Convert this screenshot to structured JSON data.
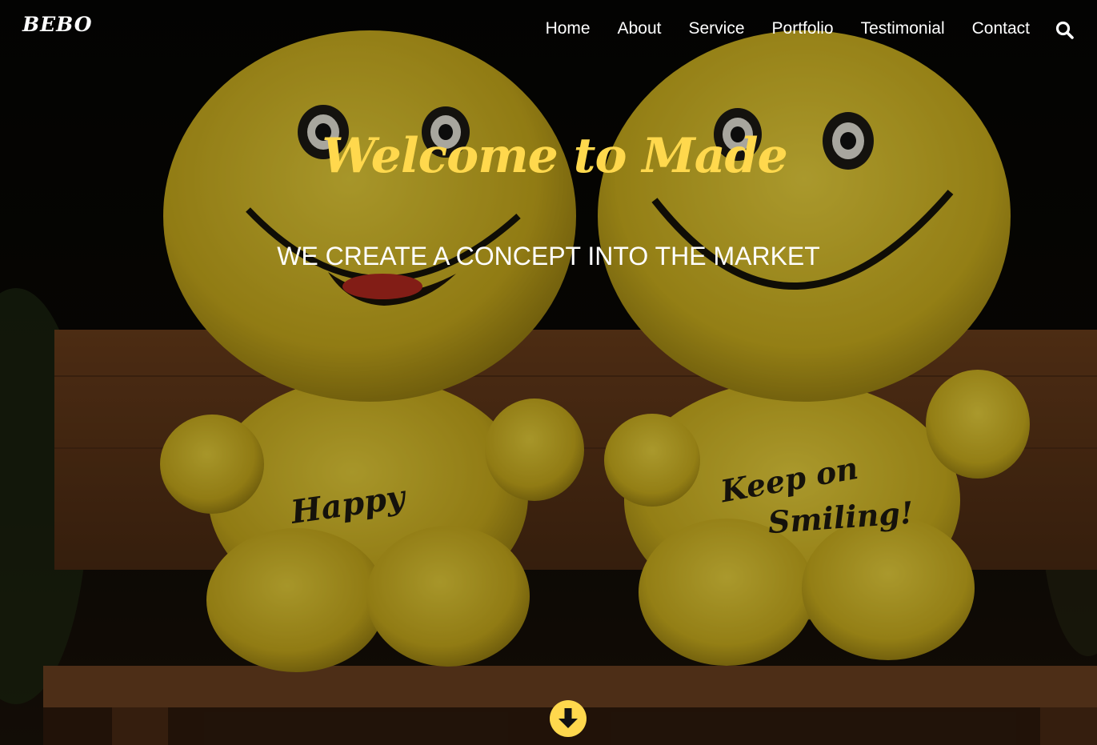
{
  "brand": {
    "name": "BEBO"
  },
  "nav": {
    "items": [
      {
        "label": "Home"
      },
      {
        "label": "About"
      },
      {
        "label": "Service"
      },
      {
        "label": "Portfolio"
      },
      {
        "label": "Testimonial"
      },
      {
        "label": "Contact"
      }
    ],
    "search_icon": "search-icon"
  },
  "hero": {
    "title": "Welcome to Made",
    "subtitle": "WE CREATE A CONCEPT INTO THE MARKET",
    "toy_left_text": "Happy",
    "toy_right_text_1": "Keep on",
    "toy_right_text_2": "Smiling!",
    "scroll_icon": "arrow-down-circle-icon"
  },
  "colors": {
    "accent": "#ffd84d",
    "text": "#ffffff",
    "background": "#0b0a05",
    "bench": "#4a2b14",
    "toy": "#e3c92a"
  }
}
